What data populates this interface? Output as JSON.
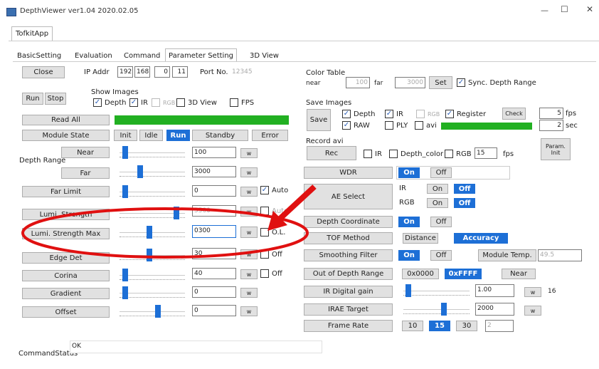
{
  "window": {
    "title": "DepthViewer ver1.04 2020.02.05",
    "minimize": "—",
    "maximize": "☐",
    "close": "✕"
  },
  "app_tab": "TofkitApp",
  "tabs": [
    "BasicSetting",
    "Evaluation",
    "Command",
    "Parameter Setting",
    "3D View"
  ],
  "active_tab": "Parameter Setting",
  "top": {
    "close_label": "Close",
    "ip_label": "IP Addr",
    "ip": [
      "192",
      "168",
      "0",
      "11"
    ],
    "port_label": "Port No.",
    "port": "12345",
    "run_label": "Run",
    "stop_label": "Stop",
    "show_images_label": "Show Images",
    "depth": "Depth",
    "ir": "IR",
    "rgb": "RGB",
    "view3d": "3D View",
    "fps": "FPS",
    "read_all": "Read All",
    "module_state": "Module State",
    "states": [
      "Init",
      "Idle",
      "Run",
      "Standby",
      "Error"
    ],
    "active_state": "Run"
  },
  "params": {
    "depth_range": "Depth Range",
    "near_label": "Near",
    "near_value": "100",
    "near_unit": "w",
    "far_label": "Far",
    "far_value": "3000",
    "far_unit": "w",
    "far_limit_label": "Far Limit",
    "far_limit_value": "0",
    "far_limit_unit": "w",
    "auto": "Auto",
    "lumi_strength_label": "Lumi. Strength",
    "lumi_strength_value": "5500",
    "lumi_strength_unit": "w",
    "lumi_strength_check": "Auto",
    "lumi_max_label": "Lumi. Strength Max",
    "lumi_max_value": "0300",
    "lumi_max_unit": "w",
    "ol": "O.L.",
    "edge_det_label": "Edge Det",
    "edge_det_value": "30",
    "edge_det_unit": "w",
    "off1": "Off",
    "corina_label": "Corina",
    "corina_value": "40",
    "corina_unit": "w",
    "off2": "Off",
    "gradient_label": "Gradient",
    "gradient_value": "0",
    "gradient_unit": "w",
    "offset_label": "Offset",
    "offset_value": "0",
    "offset_unit": "w",
    "slider_levels": {
      "near": 0.05,
      "far": 0.3,
      "far_limit": 0.05,
      "lumi_strength": 0.9,
      "lumi_max": 0.45,
      "edge_det": 0.45,
      "corina": 0.05,
      "gradient": 0.05,
      "offset": 0.6
    }
  },
  "color_table": {
    "label": "Color Table",
    "near_label": "near",
    "near_value": "100",
    "far_label": "far",
    "far_value": "3000",
    "set": "Set",
    "sync": "Sync. Depth Range"
  },
  "save_images": {
    "label": "Save Images",
    "save": "Save",
    "depth": "Depth",
    "ir": "IR",
    "rgb": "RGB",
    "register": "Register",
    "check": "Check",
    "raw": "RAW",
    "ply": "PLY",
    "avi": "avi",
    "fps_value": "5",
    "fps_unit": "fps",
    "sec_value": "2",
    "sec_unit": "sec"
  },
  "record": {
    "label": "Record avi",
    "rec": "Rec",
    "ir": "IR",
    "depth_color": "Depth_color",
    "rgb": "RGB",
    "fps_value": "15",
    "fps_unit": "fps",
    "param_init": "Param. Init"
  },
  "right": {
    "wdr": "WDR",
    "on": "On",
    "off": "Off",
    "ae_select": "AE Select",
    "ir": "IR",
    "rgb": "RGB",
    "depth_coordinate": "Depth Coordinate",
    "tof_method": "TOF Method",
    "distance": "Distance",
    "accuracy": "Accuracy",
    "smoothing": "Smoothing Filter",
    "module_temp": "Module Temp.",
    "temp_value": "49.5",
    "out_of_depth": "Out of Depth Range",
    "hex1": "0x0000",
    "hex2": "0xFFFF",
    "near": "Near",
    "ir_digital_gain": "IR Digital gain",
    "gain_value": "1.00",
    "gain_unit": "w",
    "gain_extra": "16",
    "irae_target": "IRAE Target",
    "irae_value": "2000",
    "irae_unit": "w",
    "frame_rate": "Frame Rate",
    "fr_opts": [
      "10",
      "15",
      "30"
    ],
    "fr_selected": "15",
    "fr_value": "2"
  },
  "status": {
    "label": "CommandStatus",
    "value": "OK"
  },
  "colors": {
    "accent": "#1d6fd6",
    "progress": "#22b022",
    "annotation": "#e01010"
  }
}
